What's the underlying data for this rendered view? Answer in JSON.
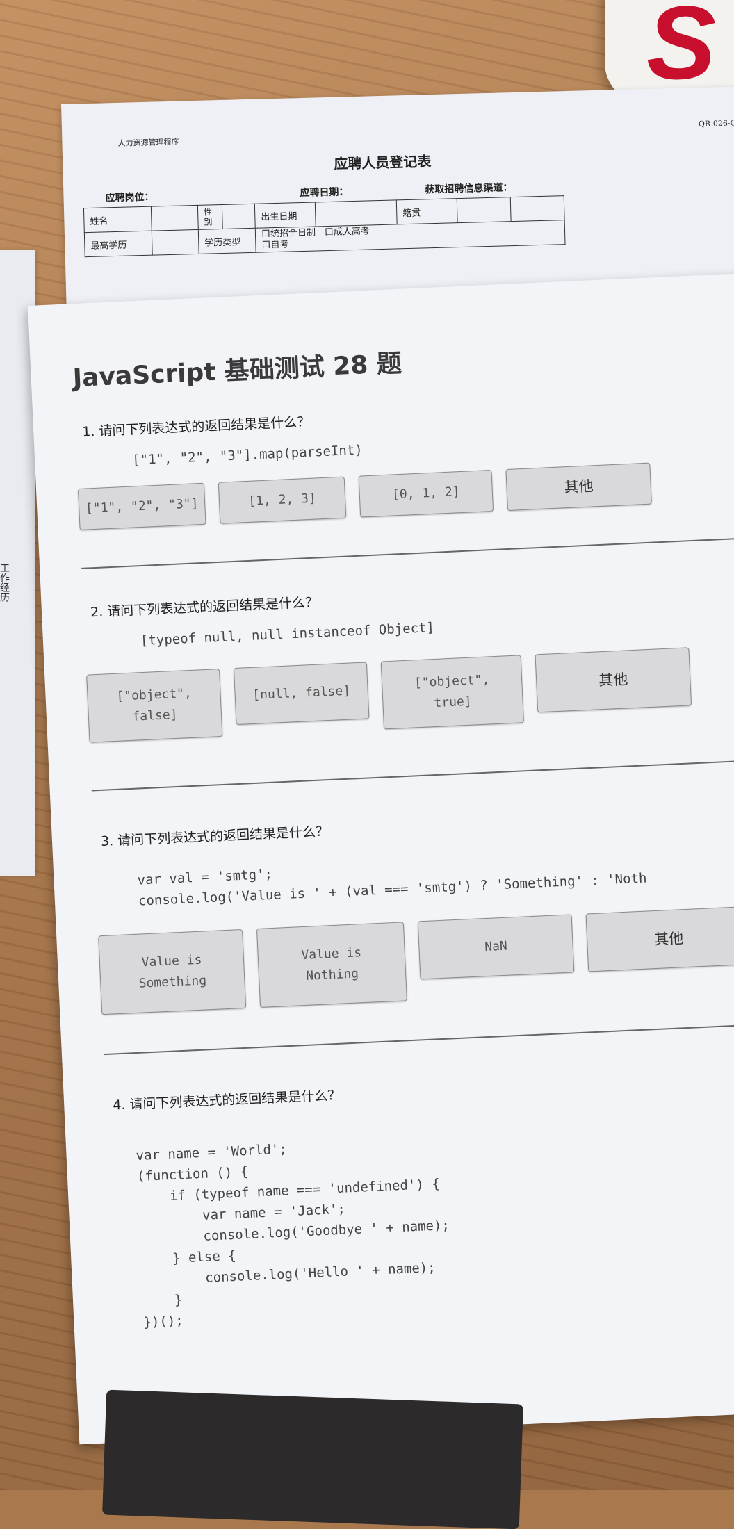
{
  "form_sheet": {
    "header_left": "人力资源管理程序",
    "header_right": "QR-026-C",
    "title": "应聘人员登记表",
    "meta": [
      "应聘岗位：",
      "应聘日期：",
      "获取招聘信息渠道："
    ],
    "row1": [
      "姓名",
      "",
      "性别",
      "",
      "出生日期",
      "",
      "籍贯",
      "",
      ""
    ],
    "row2": [
      "最高学历",
      "",
      "学历类型",
      "口统招全日制　口成人高考\n口自考"
    ]
  },
  "left_sheet_text": "工作经历",
  "quiz": {
    "title": "JavaScript 基础测试 28 题",
    "questions": [
      {
        "text": "1. 请问下列表达式的返回结果是什么？",
        "code": "[\"1\", \"2\", \"3\"].map(parseInt)",
        "options": [
          "[\"1\", \"2\", \"3\"]",
          "[1, 2, 3]",
          "[0, 1, 2]",
          "其他"
        ]
      },
      {
        "text": "2. 请问下列表达式的返回结果是什么？",
        "code": "[typeof null, null instanceof Object]",
        "options": [
          "[\"object\",\nfalse]",
          "[null, false]",
          "[\"object\",\ntrue]",
          "其他"
        ]
      },
      {
        "text": "3. 请问下列表达式的返回结果是什么？",
        "code": "var val = 'smtg';\nconsole.log('Value is ' + (val === 'smtg') ? 'Something' : 'Noth",
        "options": [
          "Value is\nSomething",
          "Value is\nNothing",
          "NaN",
          "其他"
        ]
      },
      {
        "text": "4. 请问下列表达式的返回结果是什么？",
        "code": "var name = 'World';\n(function () {\n    if (typeof name === 'undefined') {\n        var name = 'Jack';\n        console.log('Goodbye ' + name);\n    } else {\n        console.log('Hello ' + name);\n    }\n})();"
      }
    ]
  },
  "colors": {
    "paper": "#f3f4f8",
    "option_fill": "#d9d9dc",
    "mug_logo": "#c8102e",
    "wood": "#a9794d"
  },
  "mug_logo_text": "S"
}
